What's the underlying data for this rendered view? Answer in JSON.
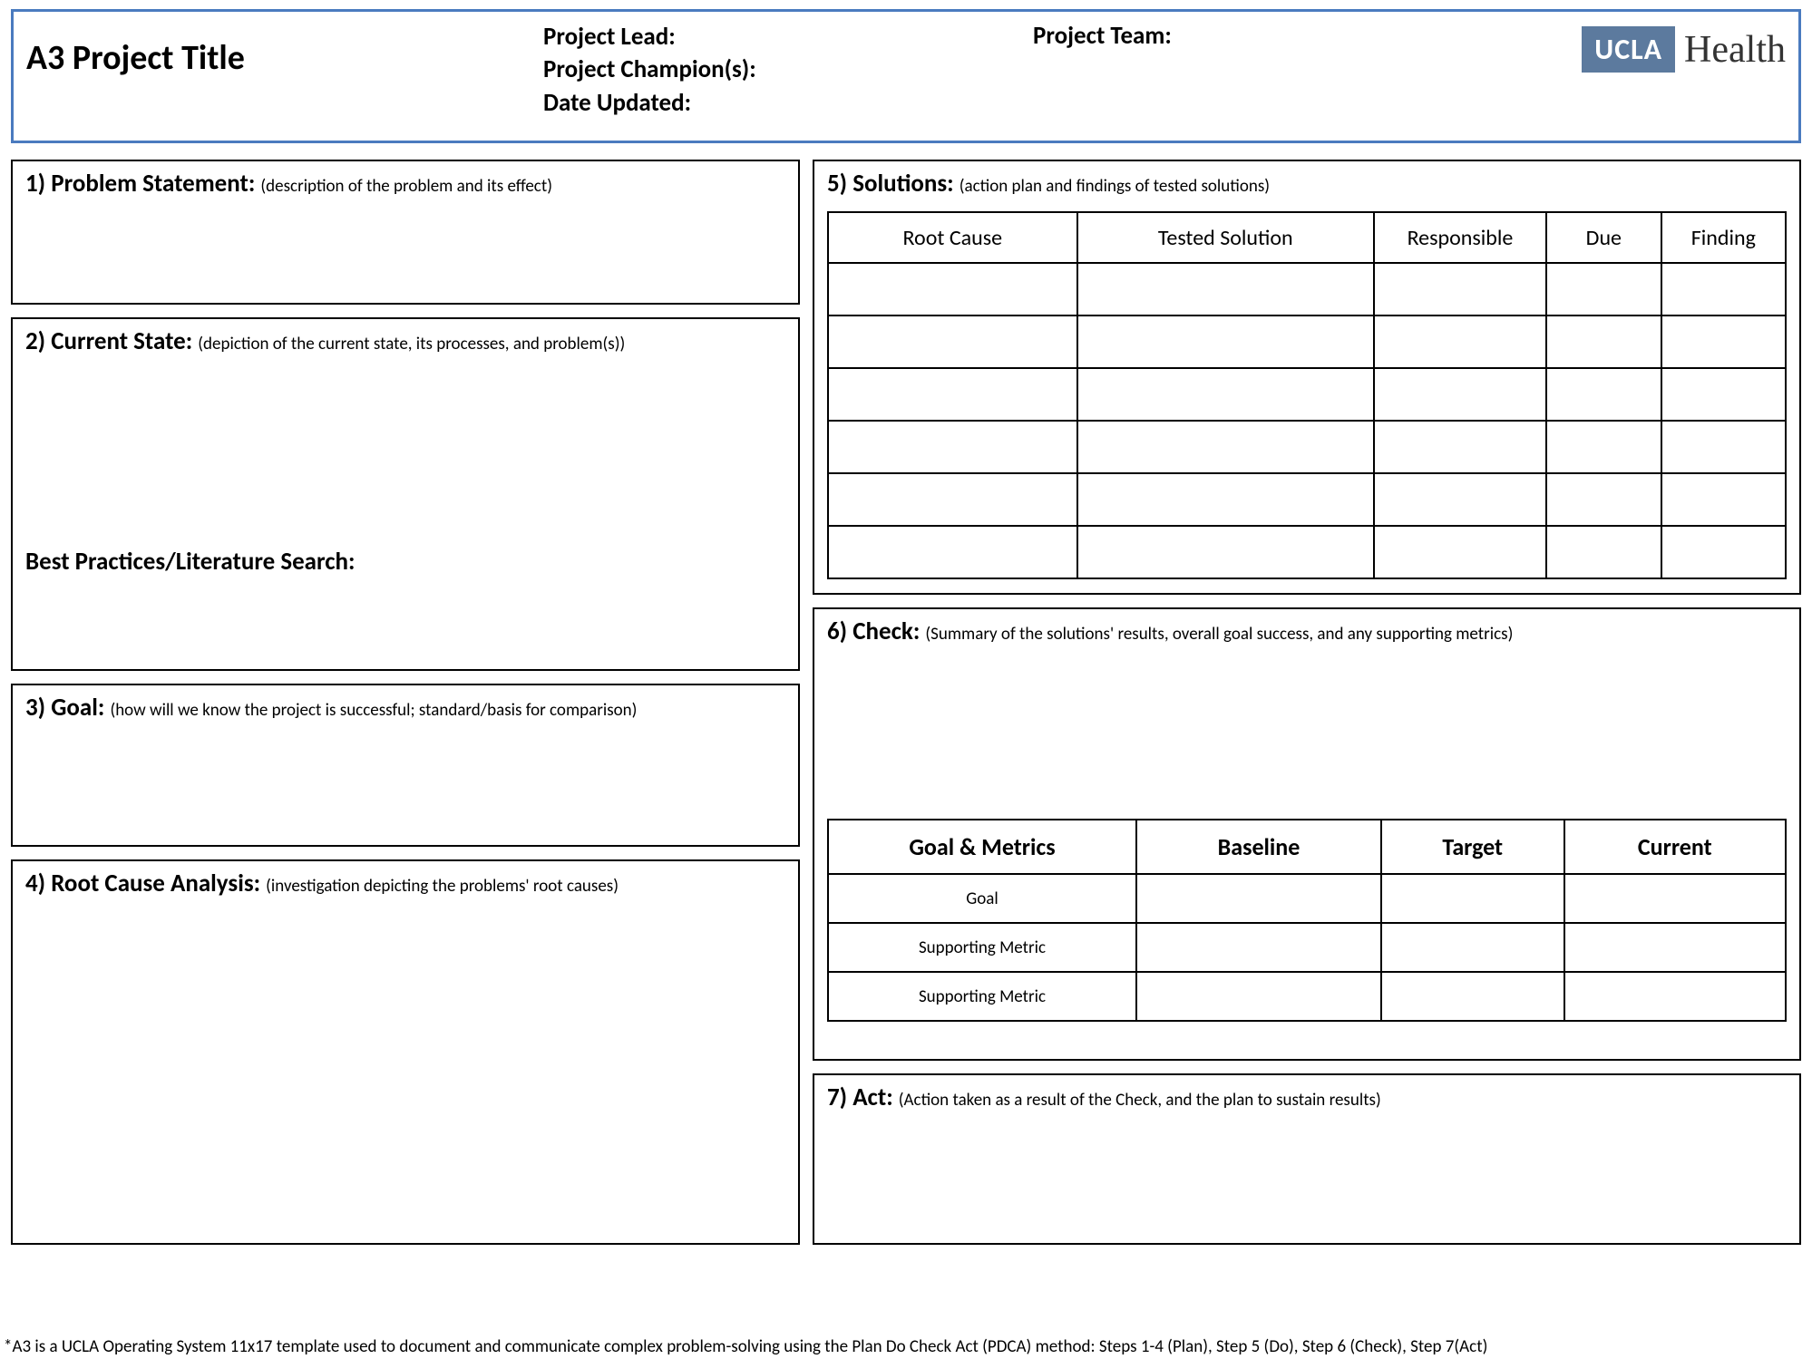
{
  "header": {
    "title": "A3 Project Title",
    "lead_label": "Project Lead:",
    "champion_label": "Project Champion(s):",
    "date_label": "Date Updated:",
    "team_label": "Project Team:",
    "logo_mark": "UCLA",
    "logo_text": "Health"
  },
  "sections": {
    "s1": {
      "title": "1) Problem Statement: ",
      "hint": "(description of the problem and its effect)"
    },
    "s2": {
      "title": "2) Current State: ",
      "hint": "(depiction of the current state, its processes, and problem(s))",
      "sub": "Best Practices/Literature Search:"
    },
    "s3": {
      "title": "3) Goal: ",
      "hint": "(how will we know the project is successful; standard/basis for comparison)"
    },
    "s4": {
      "title": "4) Root Cause Analysis: ",
      "hint": "(investigation depicting the problems' root causes)"
    },
    "s5": {
      "title": "5) Solutions: ",
      "hint": "(action plan and findings of tested solutions)"
    },
    "s6": {
      "title": "6) Check: ",
      "hint": "(Summary of the solutions' results, overall goal success, and any supporting metrics)"
    },
    "s7": {
      "title": "7) Act: ",
      "hint": "(Action taken as a result of the Check, and the plan to sustain results)"
    }
  },
  "solutions_table": {
    "headers": [
      "Root Cause",
      "Tested Solution",
      "Responsible",
      "Due",
      "Finding"
    ],
    "row_count": 6
  },
  "check_table": {
    "headers": [
      "Goal & Metrics",
      "Baseline",
      "Target",
      "Current"
    ],
    "rows": [
      "Goal",
      "Supporting Metric",
      "Supporting Metric"
    ]
  },
  "footnote": "*A3 is a UCLA Operating System 11x17 template used to document and communicate complex problem-solving using the Plan Do Check Act (PDCA) method: Steps 1-4 (Plan), Step 5 (Do), Step 6 (Check), Step 7(Act)"
}
